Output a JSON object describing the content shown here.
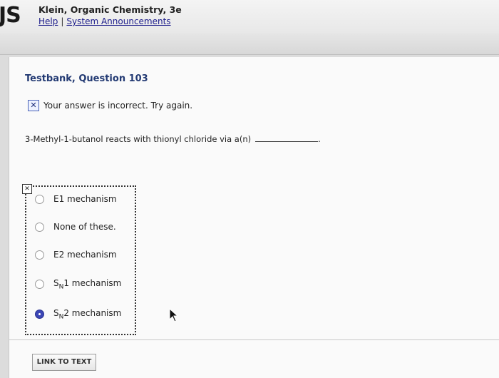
{
  "header": {
    "logo_text": "JS",
    "book_title": "Klein, Organic Chemistry, 3e",
    "links": [
      "Help",
      "System Announcements"
    ],
    "separator": "|"
  },
  "question": {
    "title": "Testbank, Question 103",
    "feedback_icon": "x-icon",
    "feedback_text": "Your answer is incorrect.  Try again.",
    "prompt": "3-Methyl-1-butanol reacts with thionyl chloride via a(n)",
    "prompt_end": "."
  },
  "choices": [
    {
      "label": "E1 mechanism",
      "selected": false
    },
    {
      "label": "None of these.",
      "selected": false
    },
    {
      "label": "E2 mechanism",
      "selected": false
    },
    {
      "label_prefix": "S",
      "label_sub": "N",
      "label_suffix": "1 mechanism",
      "selected": false
    },
    {
      "label_prefix": "S",
      "label_sub": "N",
      "label_suffix": "2 mechanism",
      "selected": true
    }
  ],
  "footer": {
    "link_button": "LINK TO TEXT"
  },
  "colors": {
    "title": "#233a73",
    "link": "#1a1a8a",
    "selected_radio": "#3b46b5"
  }
}
